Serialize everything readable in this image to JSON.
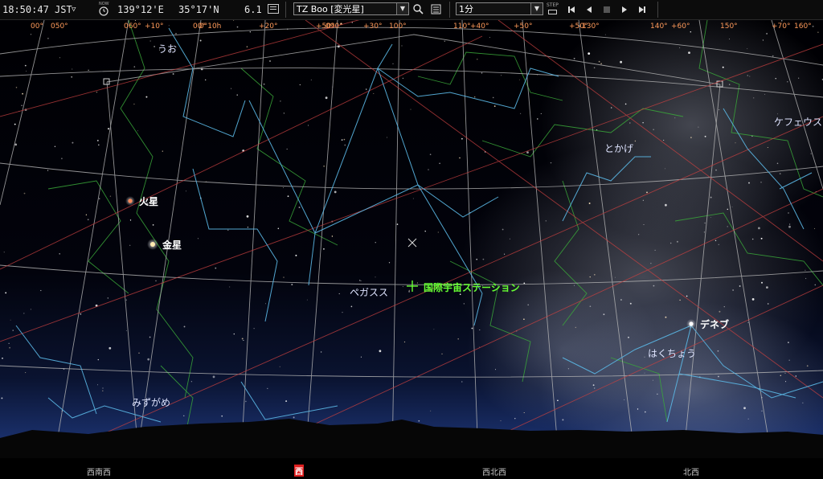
{
  "toolbar": {
    "time": "18:50:47 JST",
    "time_suffix": "▽",
    "longitude": "139°12'E",
    "latitude": "35°17'N",
    "magnitude": "6.1",
    "now_label": "NOW",
    "step_label": "STEP",
    "object_select": "TZ Boo [変光星]",
    "step_select": "1分"
  },
  "grid_labels": [
    "00°",
    "050°",
    "060°",
    "+10°",
    "00°",
    "0°10h",
    "+20°",
    "+50°",
    "090°",
    "+30°",
    "100°",
    "110°",
    "+40°",
    "+50°",
    "+50°",
    "130°",
    "140°",
    "+60°",
    "150°",
    "+70°",
    "160°"
  ],
  "constellations": [
    "うお",
    "ペガスス",
    "とかげ",
    "ケフェウス",
    "はくちょう",
    "みずがめ"
  ],
  "planets": [
    "火星",
    "金星",
    "デネブ"
  ],
  "iss_label": "国際宇宙ステーション",
  "directions": [
    "西南西",
    "西",
    "西北西",
    "北西"
  ],
  "colors": {
    "ecliptic": "#c84040",
    "grid": "#b7b7b7",
    "constellation_line": "#5bb8e6",
    "boundary": "#3aa83a",
    "iss": "#66ff33",
    "direction_highlight": "#e02020"
  }
}
